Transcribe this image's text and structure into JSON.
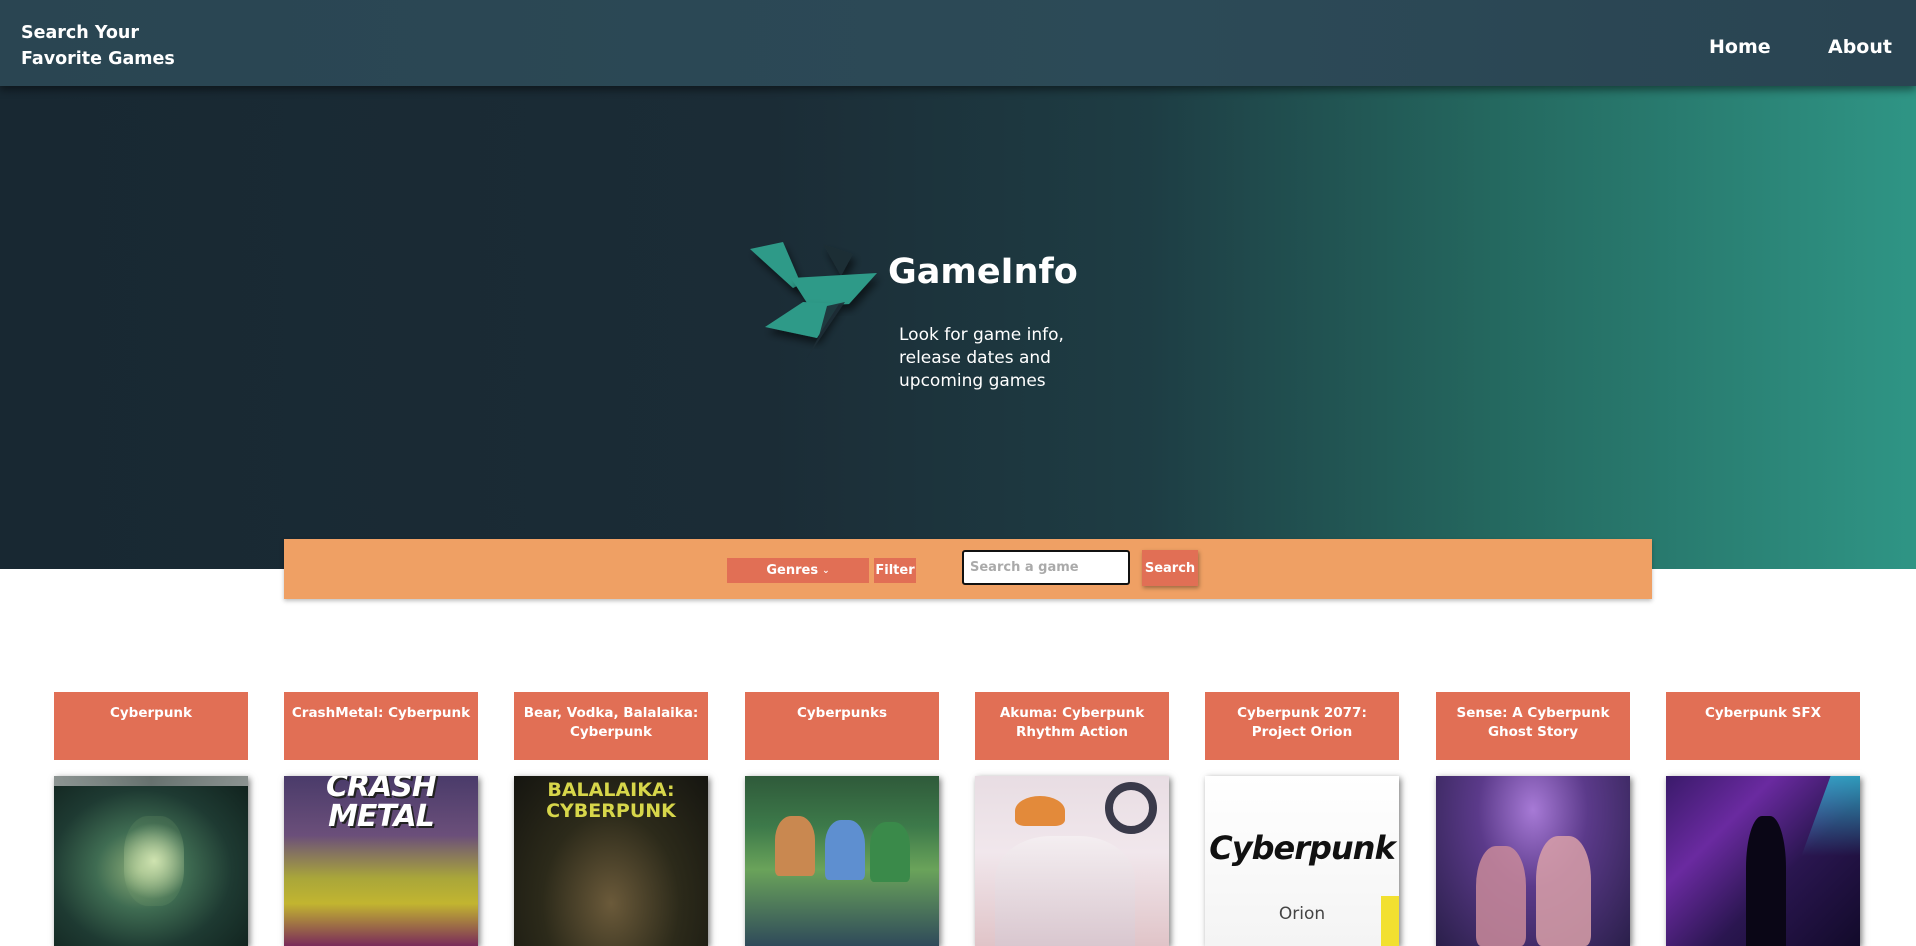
{
  "navbar": {
    "brand_line1": "Search Your",
    "brand_line2": "Favorite Games",
    "links": [
      "Home",
      "About"
    ]
  },
  "hero": {
    "title": "GameInfo",
    "tagline": "Look for game info, release dates and upcoming games"
  },
  "search": {
    "genres_label": "Genres",
    "filter_label": "Filter",
    "placeholder": "Search a game",
    "button_label": "Search"
  },
  "cards": [
    {
      "title": "Cyberpunk"
    },
    {
      "title": "CrashMetal: Cyberpunk",
      "art_text": "CRASH METAL"
    },
    {
      "title": "Bear, Vodka, Balalaika: Cyberpunk",
      "art_text": "BALALAIKA: CYBERPUNK"
    },
    {
      "title": "Cyberpunks"
    },
    {
      "title": "Akuma: Cyberpunk Rhythm Action"
    },
    {
      "title": "Cyberpunk 2077: Project Orion",
      "art_text": "Cyberpunk",
      "art_subtext": "Orion"
    },
    {
      "title": "Sense: A Cyberpunk Ghost Story"
    },
    {
      "title": "Cyberpunk SFX"
    }
  ],
  "colors": {
    "accent": "#e16f55",
    "search_bar": "#efa064",
    "navbar": "#2c4a57",
    "logo": "#2e9a88"
  }
}
